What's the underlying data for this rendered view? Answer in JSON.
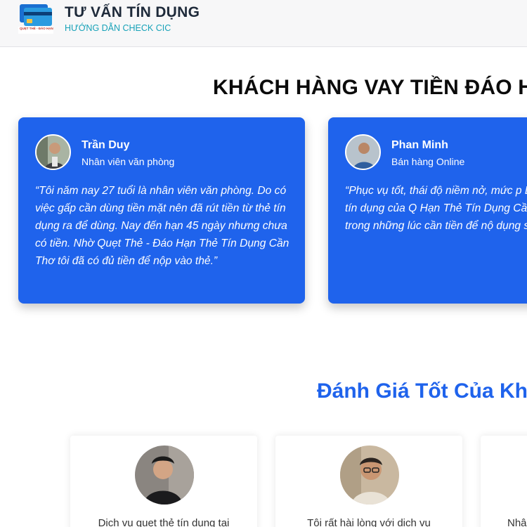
{
  "header": {
    "title": "TƯ VẤN TÍN DỤNG",
    "subtitle": "HƯỚNG DẪN CHECK CIC",
    "logo_text": "QUẸT THẺ - ĐÁO HẠN"
  },
  "testimonials": {
    "heading": "KHÁCH HÀNG VAY TIỀN ĐÁO H",
    "cards": [
      {
        "name": "Trần Duy",
        "role": "Nhân viên văn phòng",
        "quote": "“Tôi năm nay 27 tuổi là nhân viên văn phòng. Do có việc gấp cần dùng tiền mặt nên đã rút tiền từ thẻ tín dụng ra để dùng. Nay đến hạn 45 ngày nhưng chưa có tiền. Nhờ Quẹt Thẻ - Đáo Hạn Thẻ Tín Dụng Cần Thơ tôi đã có đủ tiền để nộp vào thẻ.”"
      },
      {
        "name": "Phan Minh",
        "role": "Bán hàng Online",
        "quote": "“Phục vụ tốt, thái độ niềm nở, mức p Dịch vụ đáo hạn thẻ tín dụng của Q Hạn Thẻ Tín Dụng Cần Thơ đúng là mình trong những lúc cần tiền để nộ dụng sau khi rút tiền mặt.”"
      }
    ]
  },
  "reviews": {
    "heading": "Đánh Giá Tốt Của Kh",
    "items": [
      {
        "text": "Dịch vụ quẹt thẻ tín dụng tại"
      },
      {
        "text": "Tôi rất hài lòng với dịch vụ"
      },
      {
        "text": "Nhâ"
      }
    ]
  },
  "colors": {
    "accent": "#1f63ec",
    "subtitle": "#17a2b8",
    "title": "#1e2a3a"
  }
}
